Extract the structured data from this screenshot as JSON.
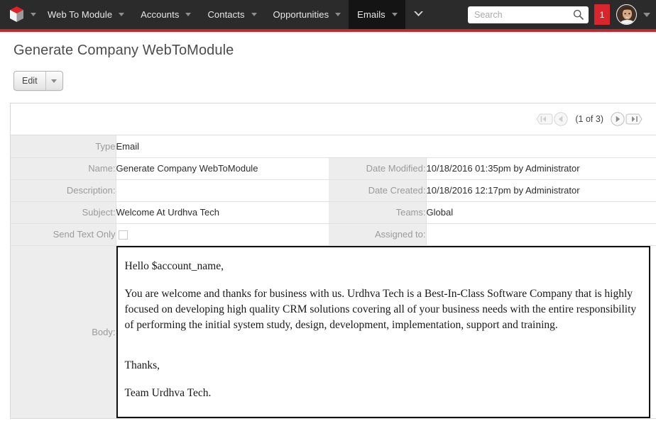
{
  "nav": {
    "logo_icon": "cube-logo-icon",
    "logo_caret_icon": "chevron-down-icon",
    "items": [
      {
        "label": "Web To Module",
        "active": false,
        "caret_icon": "chevron-down-icon"
      },
      {
        "label": "Accounts",
        "active": false,
        "caret_icon": "chevron-down-icon"
      },
      {
        "label": "Contacts",
        "active": false,
        "caret_icon": "chevron-down-icon"
      },
      {
        "label": "Opportunities",
        "active": false,
        "caret_icon": "chevron-down-icon"
      },
      {
        "label": "Emails",
        "active": true,
        "caret_icon": "chevron-down-icon"
      }
    ],
    "more_icon": "chevron-down-icon",
    "search": {
      "value": "",
      "placeholder": "Search",
      "icon": "search-icon"
    },
    "notification_count": "1",
    "avatar_icon": "user-avatar",
    "avatar_caret_icon": "chevron-down-icon",
    "colors": {
      "bar": "#2b2b2b",
      "active_tab": "#141414",
      "stripe": "#c9252c",
      "badge": "#d8262c"
    }
  },
  "page": {
    "title": "Generate Company WebToModule"
  },
  "toolbar": {
    "edit_label": "Edit",
    "edit_caret_icon": "caret-down-icon"
  },
  "pager": {
    "first_icon": "page-first-icon",
    "prev_icon": "page-prev-icon",
    "text": "(1 of 3)",
    "next_icon": "page-next-icon",
    "last_icon": "page-last-icon"
  },
  "fields": {
    "type": {
      "label": "Type",
      "value": "Email"
    },
    "name": {
      "label": "Name:",
      "value": "Generate Company WebToModule"
    },
    "description": {
      "label": "Description:",
      "value": ""
    },
    "subject": {
      "label": "Subject:",
      "value": "Welcome At Urdhva Tech"
    },
    "send_text_only": {
      "label": "Send Text Only",
      "checked": false
    },
    "date_modified": {
      "label": "Date Modified:",
      "value": "10/18/2016 01:35pm by Administrator"
    },
    "date_created": {
      "label": "Date Created:",
      "value": "10/18/2016 12:17pm by Administrator"
    },
    "teams": {
      "label": "Teams:",
      "value": "Global"
    },
    "assigned_to": {
      "label": "Assigned to:",
      "value": ""
    },
    "body": {
      "label": "Body:"
    }
  },
  "email_body": {
    "greeting": "Hello $account_name,",
    "paragraph": "You are welcome and thanks for business with us. Urdhva Tech is a Best-In-Class Software Company that is highly focused on developing high quality CRM solutions covering all of your business needs with the entire responsibility of performing the initial system study, design, development, implementation, support and training.",
    "closing": "Thanks,",
    "signature": "Team Urdhva Tech."
  }
}
